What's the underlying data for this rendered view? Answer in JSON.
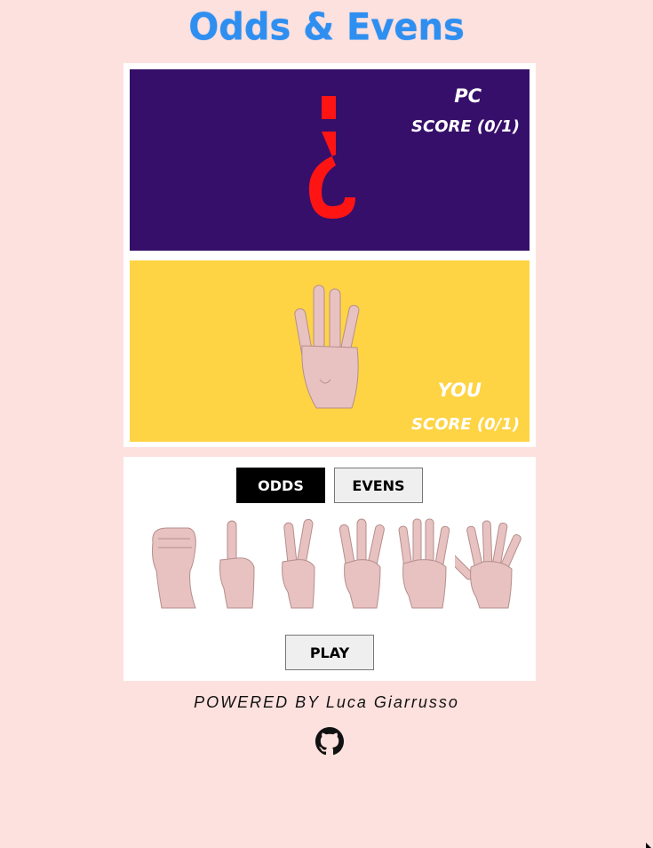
{
  "app": {
    "title": "Odds & Evens"
  },
  "pc": {
    "name": "PC",
    "score": "SCORE (0/1)",
    "display": "¿"
  },
  "you": {
    "name": "YOU",
    "score": "SCORE (0/1)"
  },
  "choices": {
    "odds": "ODDS",
    "evens": "EVENS",
    "selected": "odds"
  },
  "hands": [
    {
      "fingers": 0
    },
    {
      "fingers": 1
    },
    {
      "fingers": 2
    },
    {
      "fingers": 3
    },
    {
      "fingers": 4
    },
    {
      "fingers": 5
    }
  ],
  "play": {
    "label": "PLAY"
  },
  "footer": {
    "powered": "POWERED BY Luca Giarrusso",
    "icon": "github-icon"
  },
  "colors": {
    "background": "#fde1de",
    "title": "#2f8ff0",
    "pc_panel": "#360f6a",
    "you_panel": "#ffd444",
    "question_mark": "#ff1414"
  }
}
